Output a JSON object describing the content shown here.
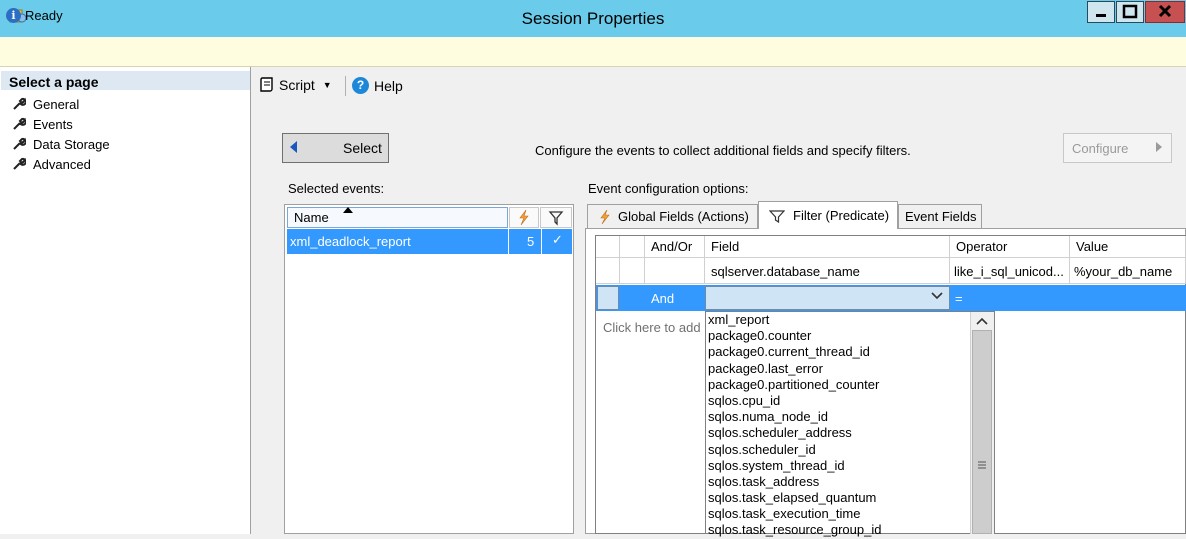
{
  "window": {
    "title": "Session Properties",
    "icons": [
      "app-icon",
      "minimize-icon",
      "maximize-icon",
      "close-icon"
    ]
  },
  "status": {
    "text": "Ready",
    "icon": "info-icon"
  },
  "sidebar": {
    "header": "Select a page",
    "items": [
      {
        "label": "General",
        "icon": "wrench-icon"
      },
      {
        "label": "Events",
        "icon": "wrench-icon"
      },
      {
        "label": "Data Storage",
        "icon": "wrench-icon"
      },
      {
        "label": "Advanced",
        "icon": "wrench-icon"
      }
    ]
  },
  "toolbar": {
    "script_label": "Script",
    "help_label": "Help"
  },
  "main": {
    "select_button": "Select",
    "configure_text": "Configure the events to collect additional fields and specify filters.",
    "configure_button": "Configure"
  },
  "selected_events": {
    "label": "Selected events:",
    "columns": {
      "name": "Name"
    },
    "rows": [
      {
        "name": "xml_deadlock_report",
        "count": "5",
        "filter": "✓"
      }
    ]
  },
  "event_config": {
    "label": "Event configuration options:",
    "tabs": [
      {
        "label": "Global Fields (Actions)",
        "icon": "lightning-icon"
      },
      {
        "label": "Filter (Predicate)",
        "icon": "filter-icon"
      },
      {
        "label": "Event Fields"
      }
    ]
  },
  "filter_grid": {
    "columns": [
      "And/Or",
      "Field",
      "Operator",
      "Value"
    ],
    "rows": [
      {
        "andor": "",
        "field": "sqlserver.database_name",
        "operator": "like_i_sql_unicod...",
        "value": "%your_db_name"
      },
      {
        "andor": "And",
        "field": "",
        "operator": "=",
        "value": ""
      }
    ],
    "add_hint": "Click here to add"
  },
  "dropdown": {
    "items": [
      "xml_report",
      "package0.counter",
      "package0.current_thread_id",
      "package0.last_error",
      "package0.partitioned_counter",
      "sqlos.cpu_id",
      "sqlos.numa_node_id",
      "sqlos.scheduler_address",
      "sqlos.scheduler_id",
      "sqlos.system_thread_id",
      "sqlos.task_address",
      "sqlos.task_elapsed_quantum",
      "sqlos.task_execution_time",
      "sqlos.task_resource_group_id"
    ]
  },
  "colors": {
    "titlebar": "#6bcbea",
    "selection": "#3399ff",
    "status_bg": "#fffde0"
  }
}
